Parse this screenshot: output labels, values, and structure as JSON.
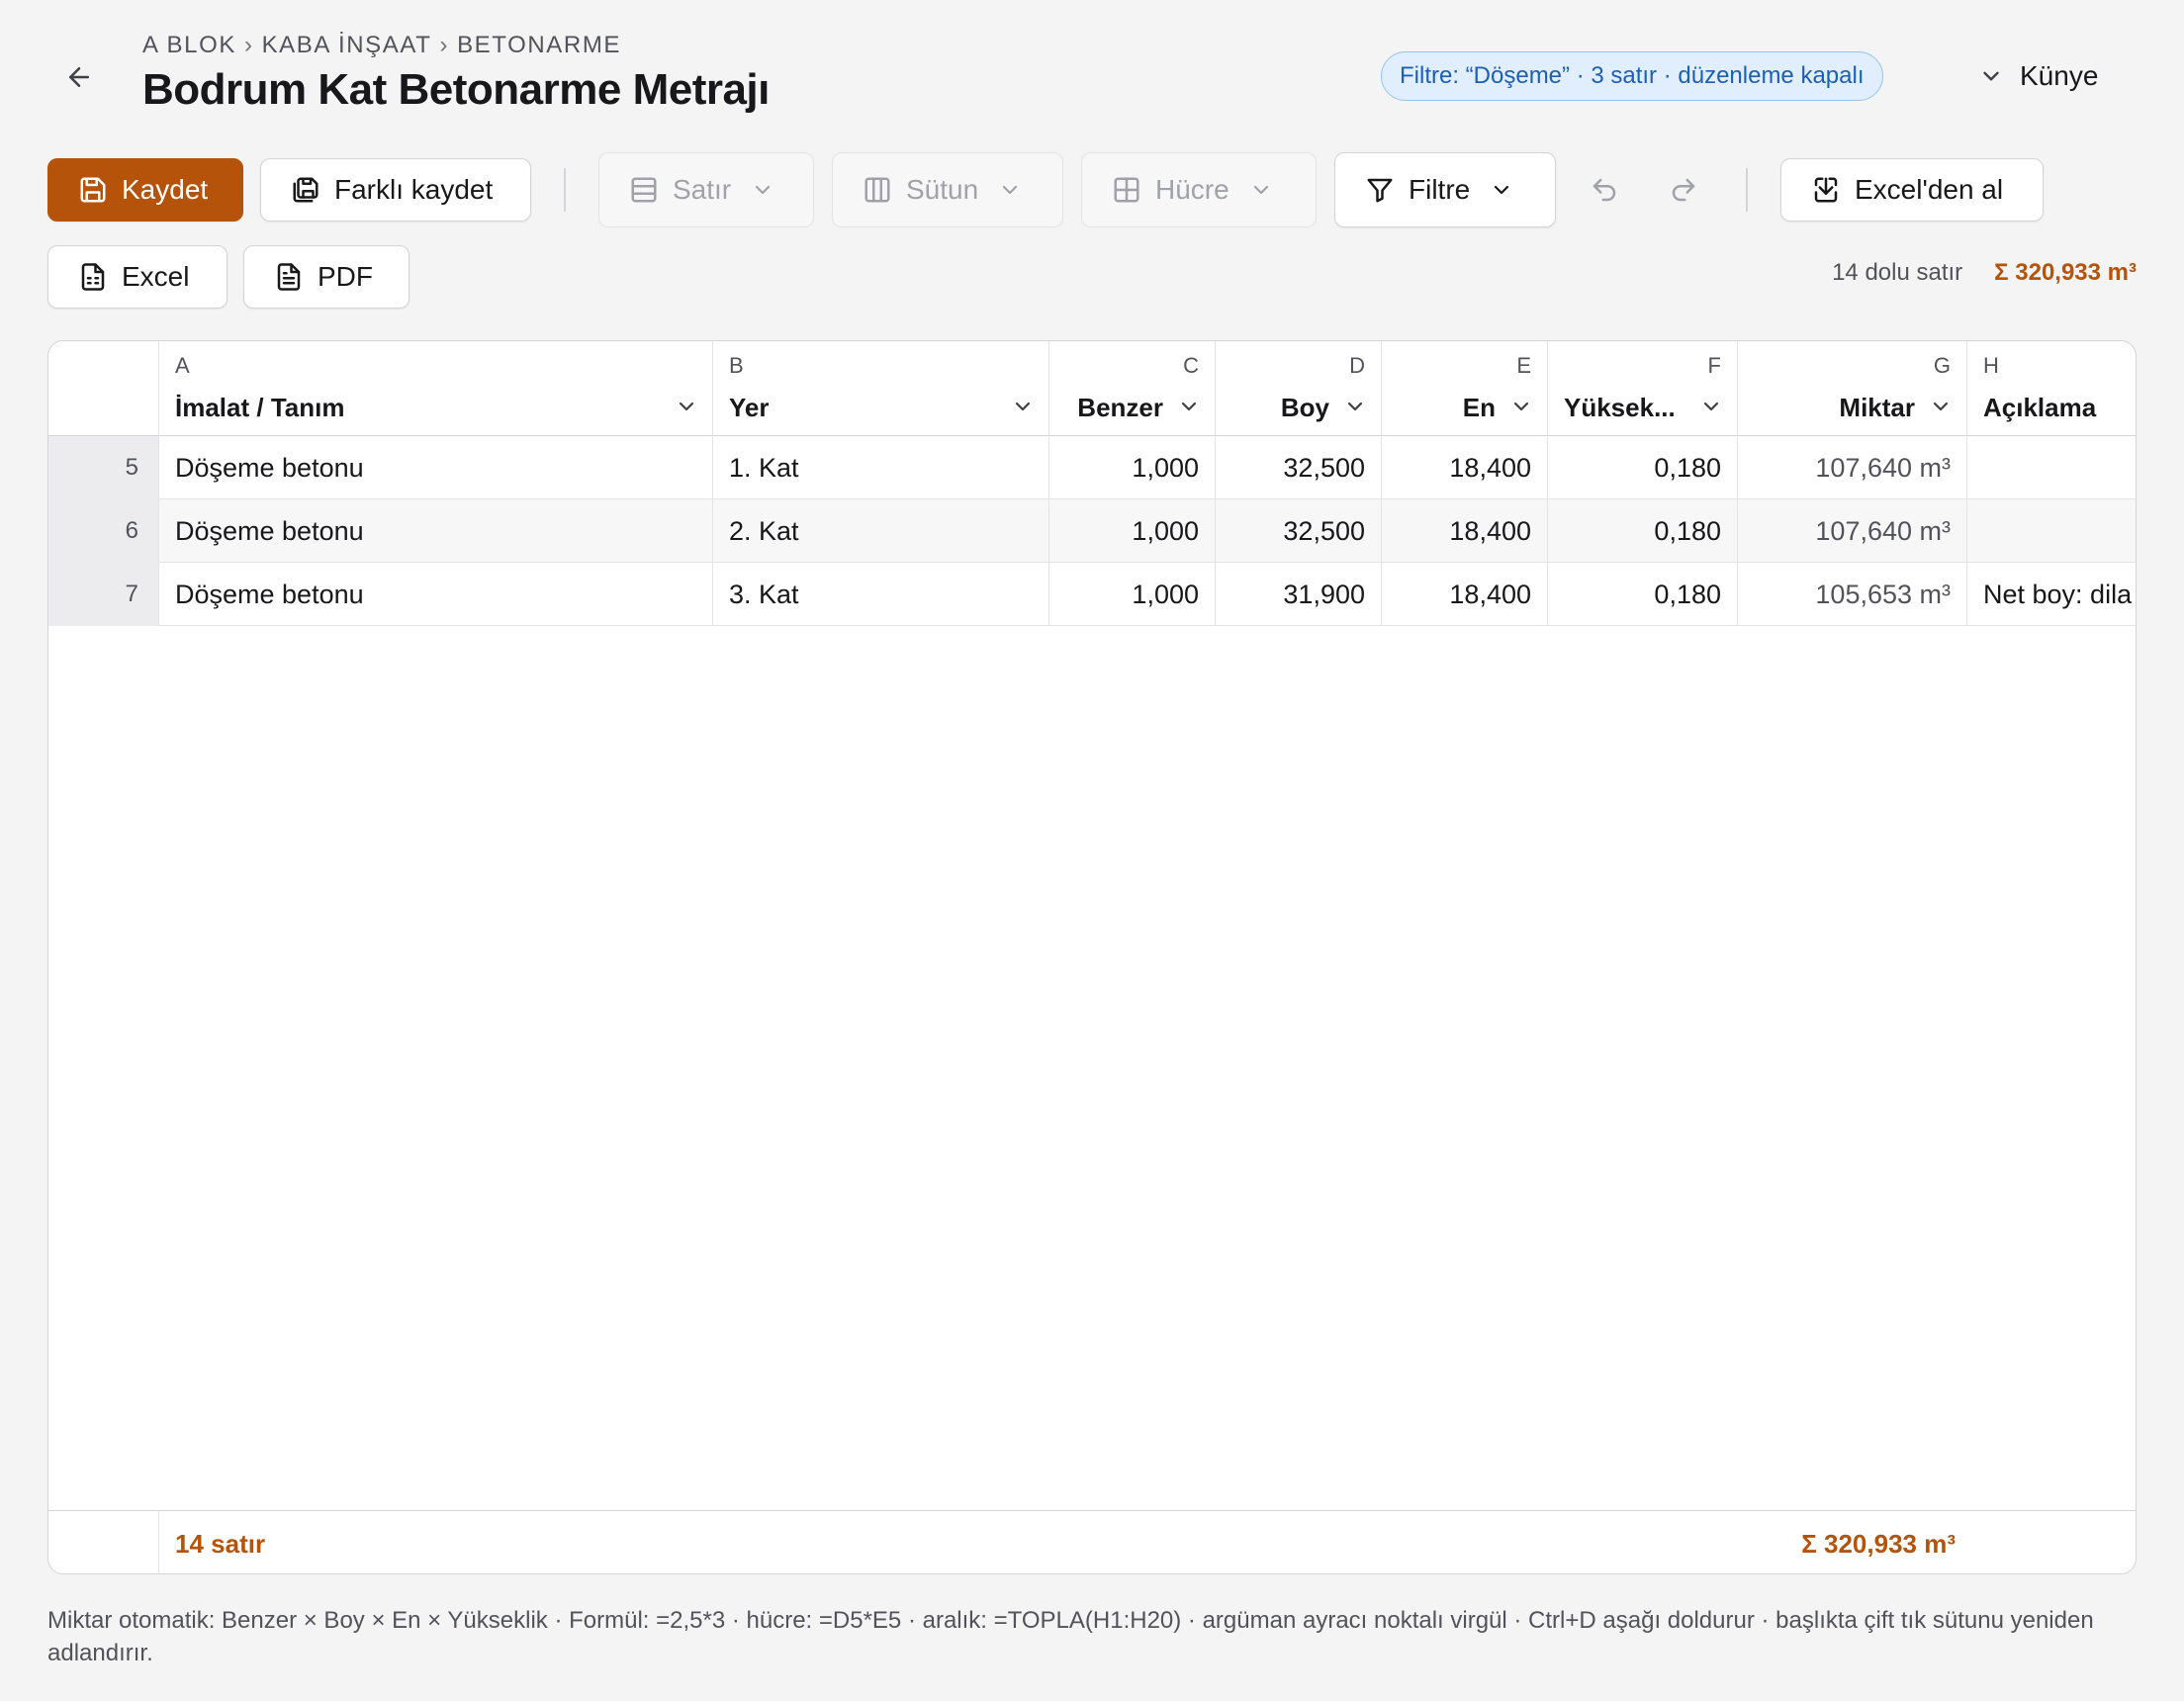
{
  "header": {
    "breadcrumb": [
      "A BLOK",
      "KABA İNŞAAT",
      "BETONARME"
    ],
    "breadcrumb_separator": "›",
    "title": "Bodrum Kat Betonarme Metrajı",
    "filter_pill": "Filtre: “Döşeme” · 3 satır · düzenleme kapalı",
    "kunye_label": "Künye"
  },
  "toolbar": {
    "save_label": "Kaydet",
    "save_as_label": "Farklı kaydet",
    "row_label": "Satır",
    "column_label": "Sütun",
    "cell_label": "Hücre",
    "filter_label": "Filtre",
    "import_excel_label": "Excel'den al",
    "export_excel_label": "Excel",
    "export_pdf_label": "PDF"
  },
  "summary": {
    "filled_rows": "14 dolu satır",
    "total": "Σ 320,933 m³"
  },
  "table": {
    "columns": [
      {
        "letter": "A",
        "name": "İmalat / Tanım"
      },
      {
        "letter": "B",
        "name": "Yer"
      },
      {
        "letter": "C",
        "name": "Benzer"
      },
      {
        "letter": "D",
        "name": "Boy"
      },
      {
        "letter": "E",
        "name": "En"
      },
      {
        "letter": "F",
        "name": "Yüksek..."
      },
      {
        "letter": "G",
        "name": "Miktar"
      },
      {
        "letter": "H",
        "name": "Açıklama"
      }
    ],
    "rows": [
      {
        "num": "5",
        "imalat": "Döşeme betonu",
        "yer": "1. Kat",
        "benzer": "1,000",
        "boy": "32,500",
        "en": "18,400",
        "yukseklik": "0,180",
        "miktar": "107,640 m³",
        "aciklama": ""
      },
      {
        "num": "6",
        "imalat": "Döşeme betonu",
        "yer": "2. Kat",
        "benzer": "1,000",
        "boy": "32,500",
        "en": "18,400",
        "yukseklik": "0,180",
        "miktar": "107,640 m³",
        "aciklama": ""
      },
      {
        "num": "7",
        "imalat": "Döşeme betonu",
        "yer": "3. Kat",
        "benzer": "1,000",
        "boy": "31,900",
        "en": "18,400",
        "yukseklik": "0,180",
        "miktar": "105,653 m³",
        "aciklama": "Net boy: dila"
      }
    ],
    "footer_count": "14 satır",
    "footer_total": "Σ 320,933 m³"
  },
  "hint": "Miktar otomatik: Benzer × Boy × En × Yükseklik · Formül: =2,5*3 · hücre: =D5*E5 · aralık: =TOPLA(H1:H20) · argüman ayracı noktalı virgül · Ctrl+D aşağı doldurur · başlıkta çift tık sütunu yeniden adlandırır.",
  "colors": {
    "accent": "#b45309",
    "filter_pill_bg": "#e0eefe",
    "filter_pill_text": "#1d5fb5"
  }
}
